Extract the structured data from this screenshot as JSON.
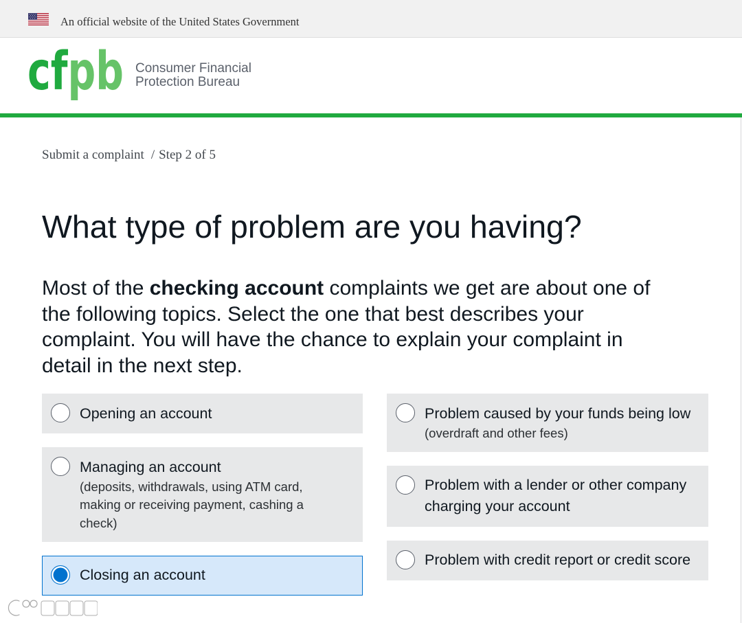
{
  "gov_banner": {
    "flag_icon": "us-flag-icon",
    "text": "An official website of the United States Government"
  },
  "header": {
    "logo": {
      "letters": [
        "c",
        "f",
        "p",
        "b"
      ]
    },
    "org_name": {
      "line1": "Consumer Financial",
      "line2": "Protection Bureau"
    }
  },
  "breadcrumb": {
    "link": "Submit a complaint",
    "separator": "/",
    "current": "Step 2 of 5"
  },
  "page_title": "What type of problem are you having?",
  "intro": {
    "before": "Most of the ",
    "bold": "checking account",
    "after": " complaints we get are about one of the following topics. Select the one that best describes your complaint. You will have the chance to explain your complaint in detail in the next step."
  },
  "options": {
    "left": [
      {
        "label": "Opening an account",
        "selected": false
      },
      {
        "label": "Managing an account",
        "detail": "(deposits, withdrawals, using ATM card, making or receiving payment, cashing a check)",
        "selected": false
      },
      {
        "label": "Closing an account",
        "selected": true
      }
    ],
    "right": [
      {
        "label": "Problem caused by your funds being low",
        "detail": "(overdraft and other fees)",
        "selected": false
      },
      {
        "label": "Problem with a lender or other company charging your account",
        "selected": false
      },
      {
        "label": "Problem with credit report or credit score",
        "selected": false
      }
    ]
  },
  "colors": {
    "brand_green": "#20aa3f",
    "logo_light_green": "#66c368",
    "option_bg": "#e7e8e9",
    "selected_bg": "#d6e8fa",
    "selected_blue": "#0072ce",
    "text": "#101820"
  },
  "watermark": {
    "text": "大数跨境"
  }
}
